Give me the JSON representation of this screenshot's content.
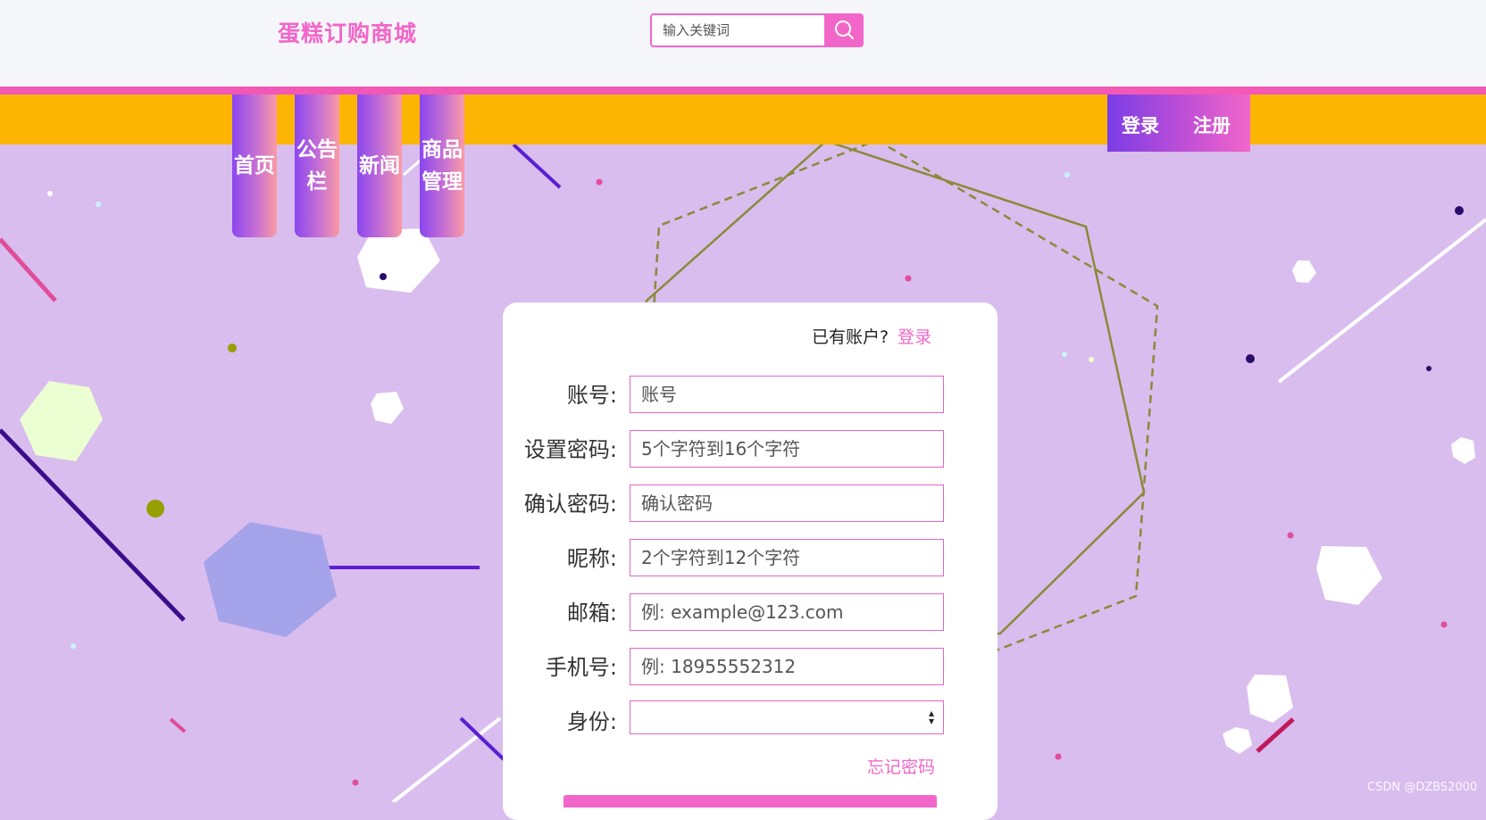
{
  "header": {
    "brand": "蛋糕订购商城",
    "search": {
      "placeholder": "输入关键词",
      "button_icon": "search-icon"
    }
  },
  "nav": {
    "items": [
      {
        "label": "首页"
      },
      {
        "label": "公告栏"
      },
      {
        "label": "新闻"
      },
      {
        "label": "商品管理"
      }
    ],
    "login": "登录",
    "register": "注册"
  },
  "form": {
    "have_account": "已有账户?",
    "login_link": "登录",
    "fields": [
      {
        "label": "账号:",
        "placeholder": "账号"
      },
      {
        "label": "设置密码:",
        "placeholder": "5个字符到16个字符"
      },
      {
        "label": "确认密码:",
        "placeholder": "确认密码"
      },
      {
        "label": "昵称:",
        "placeholder": "2个字符到12个字符"
      },
      {
        "label": "邮箱:",
        "placeholder": "例: example@123.com"
      },
      {
        "label": "手机号:",
        "placeholder": "例: 18955552312"
      },
      {
        "label": "身份:",
        "value": ""
      }
    ],
    "forgot": "忘记密码"
  },
  "watermark": "CSDN @DZBS2000",
  "colors": {
    "accent": "#f266c9",
    "nav_bar": "#fdb503",
    "background": "#d9bdee",
    "header": "#f4f6f9"
  }
}
